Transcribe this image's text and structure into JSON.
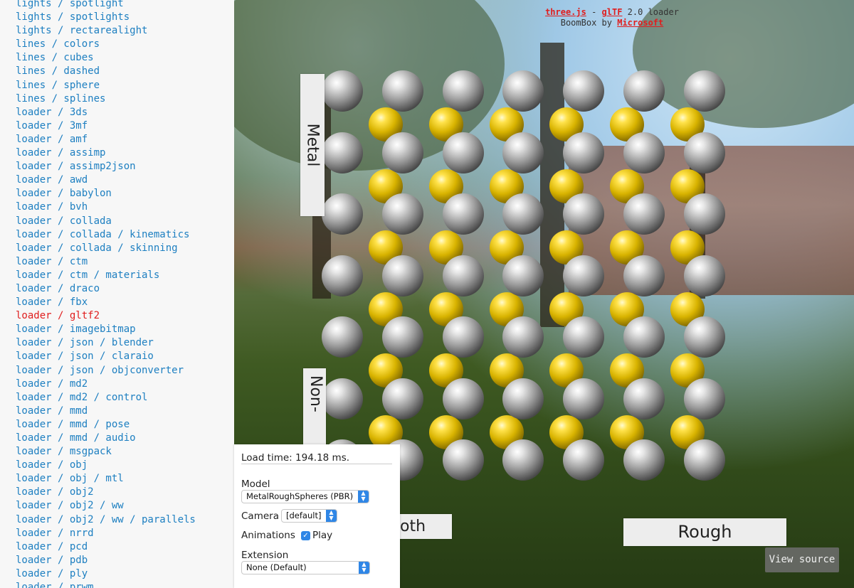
{
  "list_items": [
    "lights / spotlight",
    "lights / spotlights",
    "lights / rectarealight",
    "lines / colors",
    "lines / cubes",
    "lines / dashed",
    "lines / sphere",
    "lines / splines",
    "loader / 3ds",
    "loader / 3mf",
    "loader / amf",
    "loader / assimp",
    "loader / assimp2json",
    "loader / awd",
    "loader / babylon",
    "loader / bvh",
    "loader / collada",
    "loader / collada / kinematics",
    "loader / collada / skinning",
    "loader / ctm",
    "loader / ctm / materials",
    "loader / draco",
    "loader / fbx",
    "loader / gltf2",
    "loader / imagebitmap",
    "loader / json / blender",
    "loader / json / claraio",
    "loader / json / objconverter",
    "loader / md2",
    "loader / md2 / control",
    "loader / mmd",
    "loader / mmd / pose",
    "loader / mmd / audio",
    "loader / msgpack",
    "loader / obj",
    "loader / obj / mtl",
    "loader / obj2",
    "loader / obj2 / ww",
    "loader / obj2 / ww / parallels",
    "loader / nrrd",
    "loader / pcd",
    "loader / pdb",
    "loader / ply",
    "loader / prwm"
  ],
  "selected_index": 23,
  "colors": {
    "link": "#1d7fc1",
    "selected": "#e01e1e",
    "accent_blue": "#2f86e6"
  },
  "viewport": {
    "info_line1_link1": "three.js",
    "info_line1_sep": " - ",
    "info_line1_link2": "glTF",
    "info_line1_rest": " 2.0 loader",
    "info_line2_text": "BoomBox by ",
    "info_line2_link": "Microsoft",
    "sign_metal": "Metal",
    "sign_nonmetal": "Non-",
    "sign_smooth": "oth",
    "sign_rough": "Rough",
    "view_source": "View source"
  },
  "gui": {
    "load_time": "Load time: 194.18 ms.",
    "model_label": "Model",
    "model_value": "MetalRoughSpheres (PBR)",
    "camera_label": "Camera",
    "camera_value": "[default]",
    "animations_label": "Animations",
    "play_label": "Play",
    "play_checked": true,
    "extension_label": "Extension",
    "extension_value": "None (Default)"
  },
  "icons": {
    "checkmark": "✓",
    "select_arrow_up": "▲",
    "select_arrow_down": "▼"
  }
}
